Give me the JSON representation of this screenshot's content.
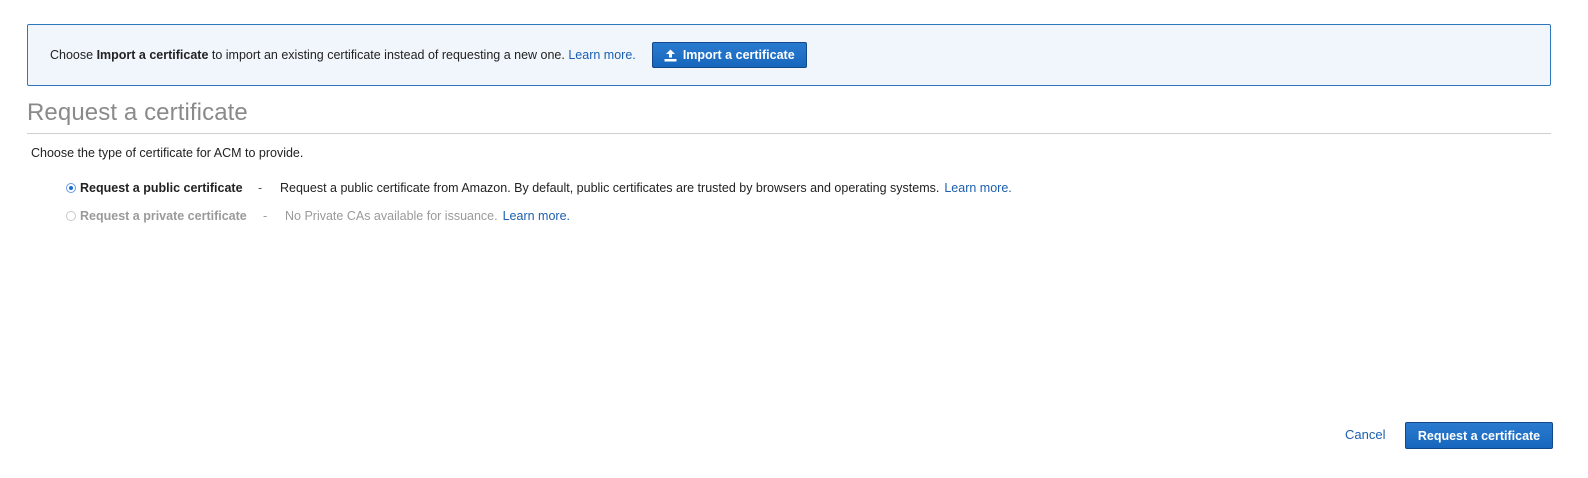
{
  "banner": {
    "text_before": "Choose ",
    "text_bold": "Import a certificate",
    "text_after": " to import an existing certificate instead of requesting a new one.",
    "learn_more": "Learn more.",
    "import_button": "Import a certificate",
    "import_icon": "upload-icon"
  },
  "title": "Request a certificate",
  "subtitle": "Choose the type of certificate for ACM to provide.",
  "options": [
    {
      "label": "Request a public certificate",
      "separator": "-",
      "description": "Request a public certificate from Amazon. By default, public certificates are trusted by browsers and operating systems.",
      "learn_more": "Learn more.",
      "selected": true,
      "disabled": false
    },
    {
      "label": "Request a private certificate",
      "separator": "-",
      "description": "No Private CAs available for issuance.",
      "learn_more": "Learn more.",
      "selected": false,
      "disabled": true
    }
  ],
  "footer": {
    "cancel": "Cancel",
    "submit": "Request a certificate"
  },
  "colors": {
    "primary": "#1766bd",
    "link": "#1d5fae",
    "banner_bg": "#f0f6fc",
    "banner_border": "#2f76bb"
  }
}
